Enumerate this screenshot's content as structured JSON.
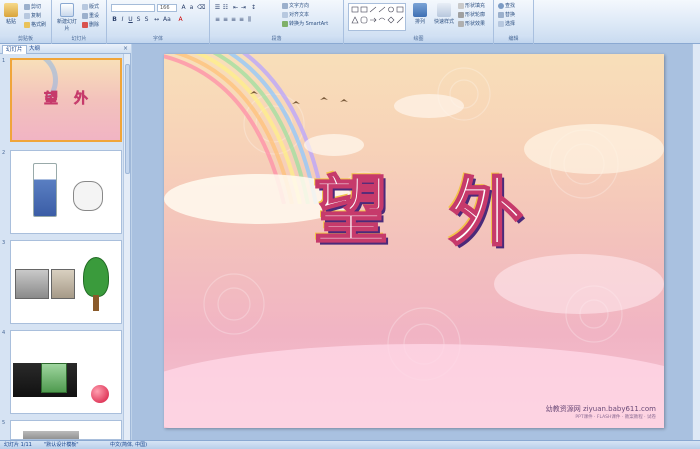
{
  "ribbon": {
    "clipboard": {
      "paste": "粘贴",
      "cut": "剪切",
      "copy": "复制",
      "format_painter": "格式刷",
      "label": "剪贴板"
    },
    "slides": {
      "new_slide": "新建幻灯片",
      "layout": "版式",
      "reset": "重设",
      "delete": "删除",
      "label": "幻灯片"
    },
    "font": {
      "font_size": "166",
      "label": "字体"
    },
    "paragraph": {
      "text_direction": "文字方向",
      "align_text": "对齐文本",
      "smartart": "转换为 SmartArt",
      "label": "段落"
    },
    "drawing": {
      "arrange": "排列",
      "quick_styles": "快速样式",
      "shape_fill": "形状填充",
      "shape_outline": "形状轮廓",
      "shape_effects": "形状效果",
      "label": "绘图"
    },
    "editing": {
      "find": "查找",
      "replace": "替换",
      "select": "选择",
      "label": "编辑"
    }
  },
  "panel": {
    "tab_slides": "幻灯片",
    "tab_outline": "大纲",
    "thumb_numbers": [
      "1",
      "2",
      "3",
      "4",
      "5"
    ]
  },
  "slide": {
    "title_char_1": "望",
    "title_char_2": "外",
    "watermark_main": "幼教资源网 ziyuan.baby611.com",
    "watermark_sub": "PPT课件 · FLASH课件 · 教案教程 · 试卷"
  },
  "status": {
    "slide_count": "幻灯片 1/11",
    "theme": "\"默认设计模板\"",
    "language": "中文(简体, 中国)"
  },
  "colors": {
    "ribbon_bg": "#dde9f7",
    "accent_selected": "#f0a53a",
    "title_stroke": "#c63a6b"
  }
}
